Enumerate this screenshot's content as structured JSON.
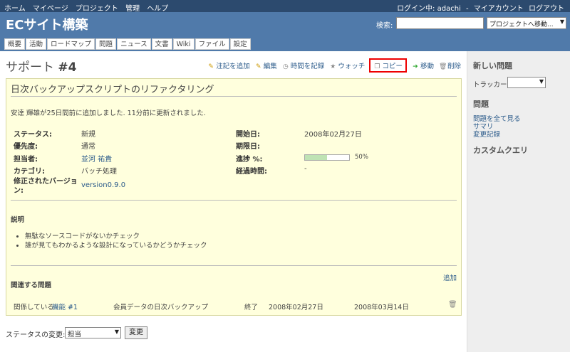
{
  "top_menu": {
    "items": [
      "ホーム",
      "マイページ",
      "プロジェクト",
      "管理",
      "ヘルプ"
    ],
    "login_text": "ログイン中: adachi",
    "separator": "-",
    "my_account": "マイアカウント",
    "logout": "ログアウト"
  },
  "header": {
    "project_title": "ECサイト構築",
    "search_label": "検索:",
    "search_value": "",
    "project_jump": "プロジェクトへ移動..."
  },
  "tabs": [
    "概要",
    "活動",
    "ロードマップ",
    "問題",
    "ニュース",
    "文書",
    "Wiki",
    "ファイル",
    "設定"
  ],
  "issue": {
    "tracker": "サポート",
    "number": "#4",
    "subject": "日次バックアップスクリプトのリファクタリング",
    "author_line": "安達 輝雄が25日間前に追加しました. 11分前に更新されました.",
    "actions": {
      "add_note": "注記を追加",
      "edit": "編集",
      "log_time": "時間を記録",
      "watch": "ウォッチ",
      "copy": "コピー",
      "move": "移動",
      "delete": "削除"
    },
    "attributes": {
      "status_label": "ステータス:",
      "status": "新規",
      "priority_label": "優先度:",
      "priority": "通常",
      "assignee_label": "担当者:",
      "assignee": "並河 祐貴",
      "category_label": "カテゴリ:",
      "category": "バッチ処理",
      "version_label": "修正されたバージョン:",
      "version": "version0.9.0",
      "start_label": "開始日:",
      "start": "2008年02月27日",
      "due_label": "期限日:",
      "due": "",
      "progress_label": "進捗 %:",
      "progress_pct": "50%",
      "progress": 0.5,
      "spent_label": "経過時間:",
      "spent": "-"
    },
    "description_label": "説明",
    "description_items": [
      "無駄なソースコードがないかチェック",
      "誰が見てもわかるような設計になっているかどうかチェック"
    ],
    "related_label": "関連する問題",
    "related_add": "追加",
    "related": [
      {
        "relation": "関係している",
        "issue_link": "機能 #1",
        "subject": "会員データの日次バックアップ",
        "status": "終了",
        "start": "2008年02月27日",
        "due": "2008年03月14日"
      }
    ]
  },
  "status_change": {
    "label": "ステータスの変更:",
    "selected": "担当",
    "button": "変更"
  },
  "sidebar": {
    "new_issue": "新しい問題",
    "tracker_label": "トラッカー:",
    "issues_heading": "問題",
    "links": [
      "問題を全て見る",
      "サマリ",
      "変更記録"
    ],
    "custom_query": "カスタムクエリ"
  },
  "colors": {
    "topbar": "#2c4a6e",
    "header": "#507aaa",
    "issue_bg": "#ffffdd",
    "link": "#2a5a8a",
    "highlight": "#ee0000"
  }
}
